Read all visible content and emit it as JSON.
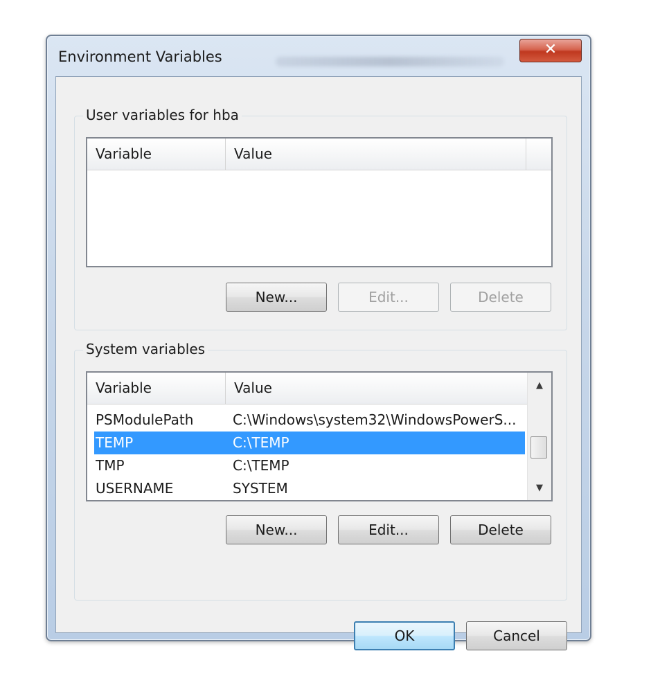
{
  "window": {
    "title": "Environment Variables",
    "close_symbol": "✕"
  },
  "user_variables": {
    "group_label": "User variables for hba",
    "columns": [
      "Variable",
      "Value"
    ],
    "rows": [],
    "buttons": {
      "new": "New...",
      "edit": "Edit...",
      "delete": "Delete"
    }
  },
  "system_variables": {
    "group_label": "System variables",
    "columns": [
      "Variable",
      "Value"
    ],
    "rows": [
      {
        "variable": "PSModulePath",
        "value": "C:\\Windows\\system32\\WindowsPowerS..."
      },
      {
        "variable": "TEMP",
        "value": "C:\\TEMP",
        "selected": true
      },
      {
        "variable": "TMP",
        "value": "C:\\TEMP"
      },
      {
        "variable": "USERNAME",
        "value": "SYSTEM"
      }
    ],
    "scroll_up_symbol": "▲",
    "scroll_down_symbol": "▼",
    "buttons": {
      "new": "New...",
      "edit": "Edit...",
      "delete": "Delete"
    }
  },
  "dialog_buttons": {
    "ok": "OK",
    "cancel": "Cancel"
  },
  "colors": {
    "selection": "#3399ff",
    "close_button": "#c0381f",
    "default_button_border": "#3c7fb1"
  }
}
